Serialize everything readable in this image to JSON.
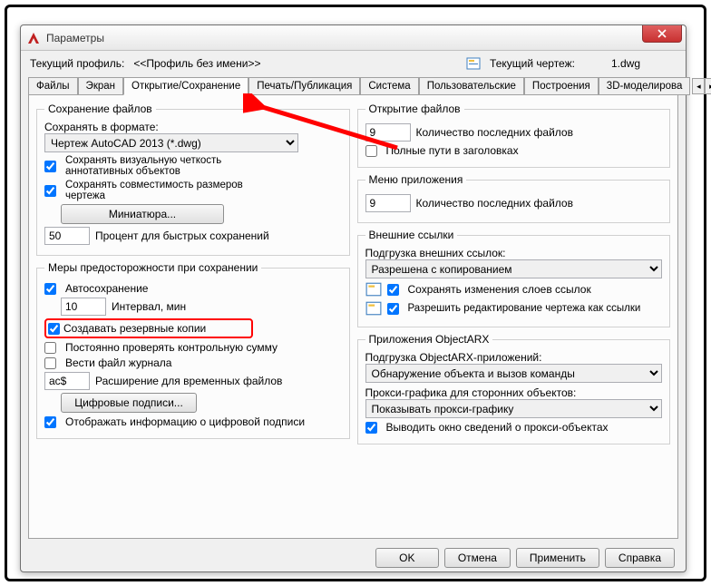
{
  "window": {
    "title": "Параметры"
  },
  "header": {
    "profile_label": "Текущий профиль:",
    "profile_value": "<<Профиль без имени>>",
    "drawing_label": "Текущий чертеж:",
    "drawing_value": "1.dwg"
  },
  "tabs": {
    "t0": "Файлы",
    "t1": "Экран",
    "t2": "Открытие/Сохранение",
    "t3": "Печать/Публикация",
    "t4": "Система",
    "t5": "Пользовательские",
    "t6": "Построения",
    "t7": "3D-моделирова"
  },
  "left": {
    "group1_title": "Сохранение файлов",
    "save_as_label": "Сохранять в формате:",
    "save_as_value": "Чертеж AutoCAD 2013 (*.dwg)",
    "visual_fidelity": "Сохранять визуальную четкость аннотативных объектов",
    "size_compat": "Сохранять совместимость размеров чертежа",
    "thumbnail_btn": "Миниатюра...",
    "percent_value": "50",
    "percent_label": "Процент для быстрых сохранений",
    "group2_title": "Меры предосторожности при сохранении",
    "autosave": "Автосохранение",
    "interval_value": "10",
    "interval_label": "Интервал, мин",
    "backup": "Создавать резервные копии",
    "crc": "Постоянно проверять контрольную сумму",
    "log": "Вести файл журнала",
    "ext_value": "ac$",
    "ext_label": "Расширение для временных файлов",
    "sig_btn": "Цифровые подписи...",
    "show_sig": "Отображать информацию о цифровой подписи"
  },
  "right": {
    "group1_title": "Открытие файлов",
    "recent_value": "9",
    "recent_label": "Количество последних файлов",
    "full_paths": "Полные пути в заголовках",
    "group2_title": "Меню приложения",
    "menu_recent_value": "9",
    "menu_recent_label": "Количество последних файлов",
    "group3_title": "Внешние ссылки",
    "xref_load_label": "Подгрузка внешних ссылок:",
    "xref_load_value": "Разрешена с копированием",
    "xref_layers": "Сохранять изменения слоев ссылок",
    "xref_edit": "Разрешить редактирование чертежа как ссылки",
    "group4_title": "Приложения ObjectARX",
    "arx_load_label": "Подгрузка ObjectARX-приложений:",
    "arx_load_value": "Обнаружение объекта и вызов команды",
    "proxy_label": "Прокси-графика для сторонних объектов:",
    "proxy_value": "Показывать прокси-графику",
    "proxy_info": "Выводить окно сведений о прокси-объектах"
  },
  "footer": {
    "ok": "OK",
    "cancel": "Отмена",
    "apply": "Применить",
    "help": "Справка"
  }
}
